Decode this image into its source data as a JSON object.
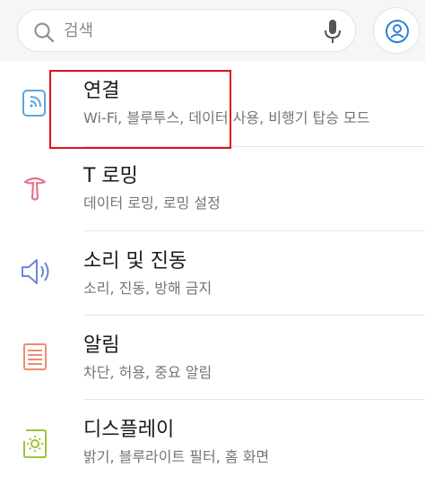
{
  "search": {
    "placeholder": "검색"
  },
  "items": [
    {
      "title": "연결",
      "subtitle": "Wi-Fi, 블루투스, 데이터 사용, 비행기 탑승 모드",
      "icon": "connection-icon"
    },
    {
      "title": "T 로밍",
      "subtitle": "데이터 로밍, 로밍 설정",
      "icon": "roaming-icon"
    },
    {
      "title": "소리 및 진동",
      "subtitle": "소리, 진동, 방해 금지",
      "icon": "sound-icon"
    },
    {
      "title": "알림",
      "subtitle": "차단, 허용, 중요 알림",
      "icon": "notification-icon"
    },
    {
      "title": "디스플레이",
      "subtitle": "밝기, 블루라이트 필터, 홈 화면",
      "icon": "display-icon"
    }
  ],
  "colors": {
    "highlight": "#e0101b",
    "connection": "#5aa6e0",
    "roaming": "#e8738c",
    "sound": "#6a86d8",
    "notification": "#ef8b72",
    "display": "#9bc43b"
  }
}
